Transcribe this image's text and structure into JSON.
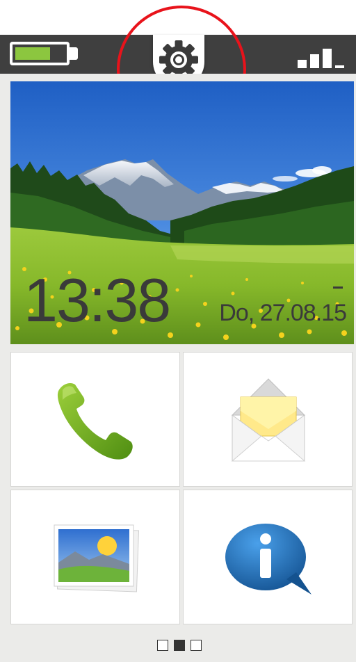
{
  "status_bar": {
    "battery_level": 0.72,
    "battery_color": "#8cc63f",
    "battery_icon": "battery-icon",
    "signal_icon": "signal-strength-icon",
    "signal_bars": 3,
    "signal_bars_total": 4,
    "settings_icon": "gear-icon",
    "highlight_color": "#e8131b"
  },
  "home": {
    "time": "13:38",
    "date": "Do, 27.08.15"
  },
  "tiles": [
    {
      "name": "phone",
      "icon": "phone-handset-icon"
    },
    {
      "name": "messages",
      "icon": "envelope-icon"
    },
    {
      "name": "gallery",
      "icon": "photo-icon"
    },
    {
      "name": "info",
      "icon": "info-bubble-icon"
    }
  ],
  "pager": {
    "pages": 3,
    "current": 2
  }
}
